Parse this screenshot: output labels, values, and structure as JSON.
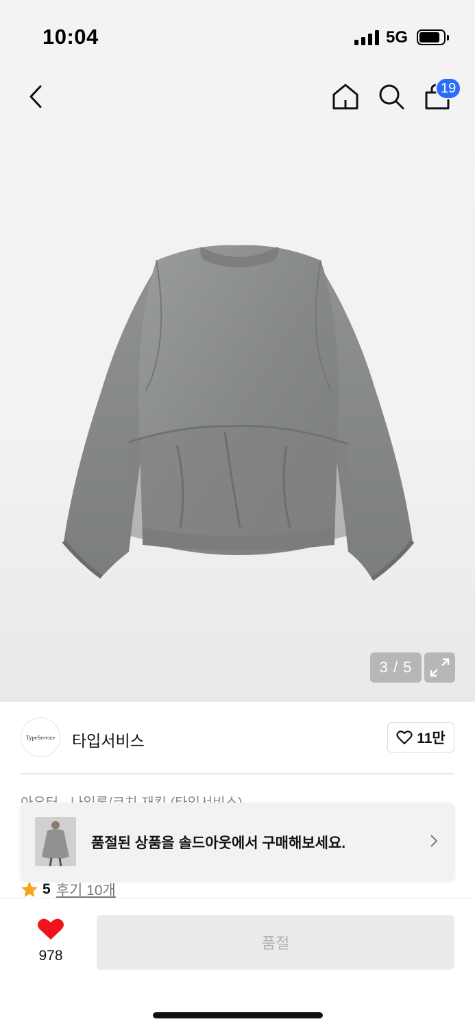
{
  "status": {
    "time": "10:04",
    "network": "5G"
  },
  "nav": {
    "cart_count": "19"
  },
  "gallery": {
    "pager": "3 / 5"
  },
  "brand": {
    "logo_text": "TypeService",
    "name": "타입서비스",
    "likes": "11만"
  },
  "product": {
    "category_line": "아우터 · 나일론/코치 재킷 (타입서비스)",
    "rating": "5",
    "reviews": "후기 10개"
  },
  "soldout_banner": {
    "text": "품절된 상품을 솔드아웃에서 구매해보세요."
  },
  "bottom": {
    "wish_count": "978",
    "buy_label": "품절"
  },
  "colors": {
    "badge": "#2a6df6",
    "heart": "#f0131b",
    "star": "#f6a51f",
    "jacket": "#8c8f8e"
  }
}
